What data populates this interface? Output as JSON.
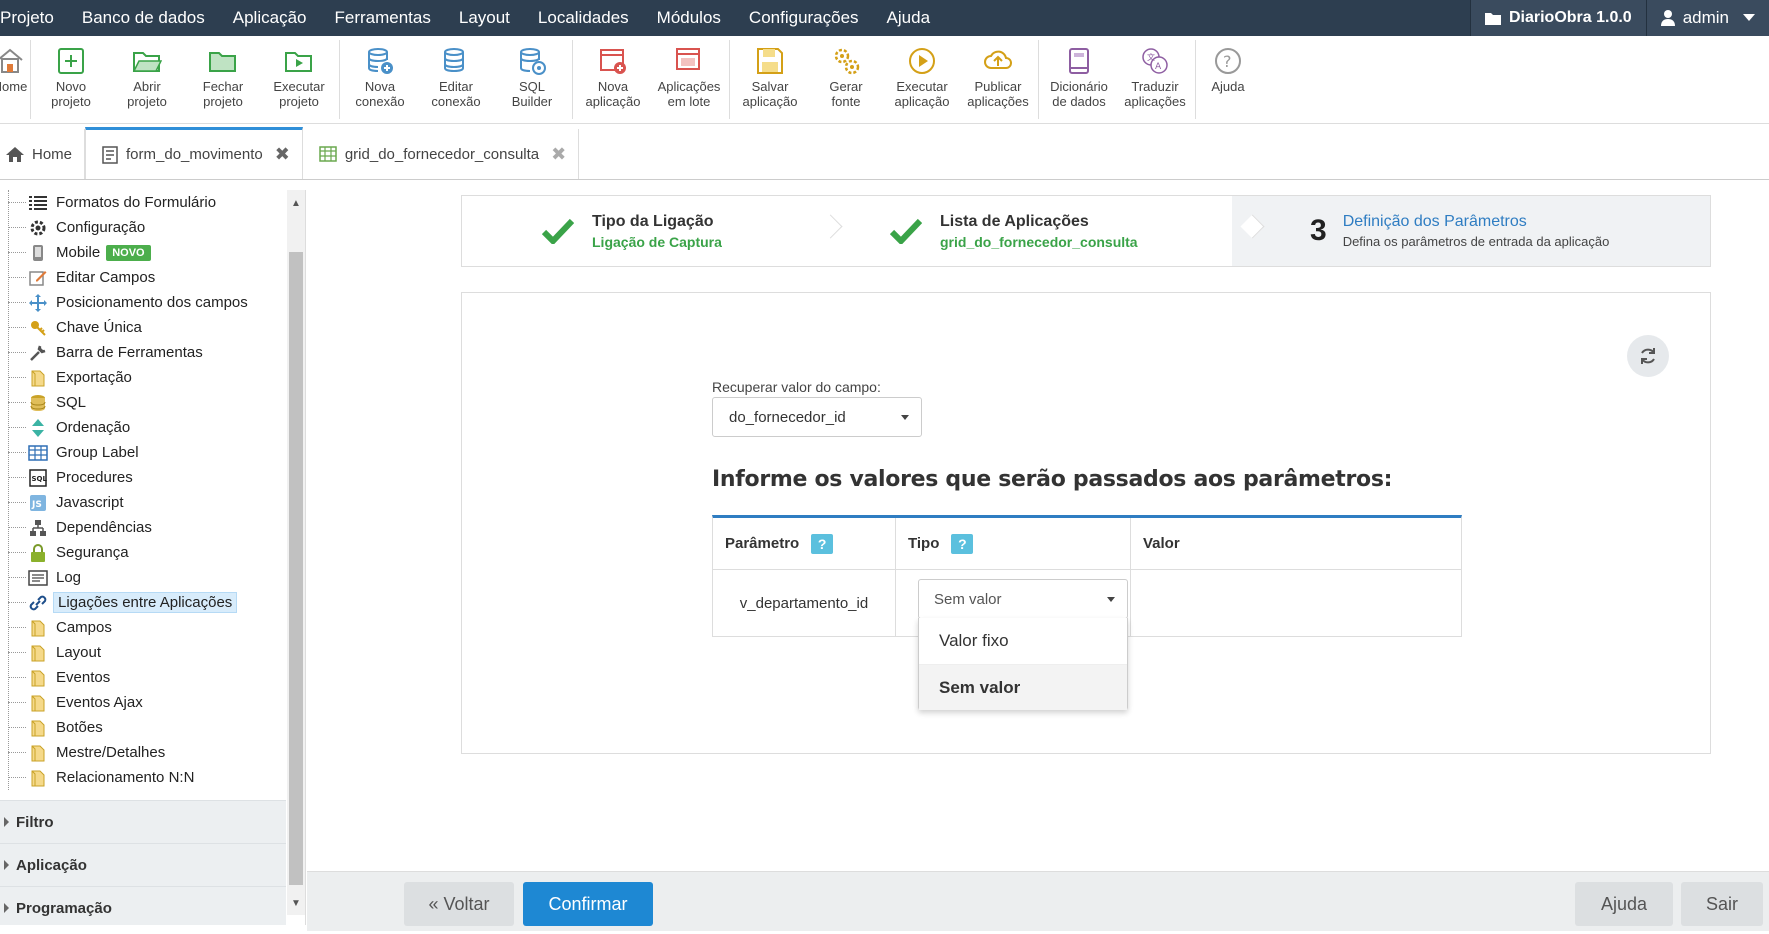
{
  "menubar": {
    "items": [
      "Projeto",
      "Banco de dados",
      "Aplicação",
      "Ferramentas",
      "Layout",
      "Localidades",
      "Módulos",
      "Configurações",
      "Ajuda"
    ],
    "project": "DiarioObra 1.0.0",
    "user": "admin"
  },
  "toolbar": {
    "home": "Home",
    "novo_projeto": [
      "Novo",
      "projeto"
    ],
    "abrir_projeto": [
      "Abrir",
      "projeto"
    ],
    "fechar_projeto": [
      "Fechar",
      "projeto"
    ],
    "executar_projeto": [
      "Executar",
      "projeto"
    ],
    "nova_conexao": [
      "Nova",
      "conexão"
    ],
    "editar_conexao": [
      "Editar",
      "conexão"
    ],
    "sql_builder": [
      "SQL",
      "Builder"
    ],
    "nova_aplicacao": [
      "Nova",
      "aplicação"
    ],
    "aplicacoes_lote": [
      "Aplicações",
      "em lote"
    ],
    "salvar_aplicacao": [
      "Salvar",
      "aplicação"
    ],
    "gerar_fonte": [
      "Gerar",
      "fonte"
    ],
    "executar_aplicacao": [
      "Executar",
      "aplicação"
    ],
    "publicar_aplicacoes": [
      "Publicar",
      "aplicações"
    ],
    "dicionario": [
      "Dicionário",
      "de dados"
    ],
    "traduzir": [
      "Traduzir",
      "aplicações"
    ],
    "ajuda": "Ajuda"
  },
  "tabs": {
    "home": "Home",
    "form": "form_do_movimento",
    "grid": "grid_do_fornecedor_consulta"
  },
  "sidebar": {
    "items": {
      "formatos": "Formatos do Formulário",
      "configuracao": "Configuração",
      "mobile": "Mobile",
      "mobile_badge": "NOVO",
      "editar_campos": "Editar Campos",
      "posicionamento": "Posicionamento dos campos",
      "chave_unica": "Chave Única",
      "barra_ferramentas": "Barra de Ferramentas",
      "exportacao": "Exportação",
      "sql": "SQL",
      "ordenacao": "Ordenação",
      "group_label": "Group Label",
      "procedures": "Procedures",
      "javascript": "Javascript",
      "dependencias": "Dependências",
      "seguranca": "Segurança",
      "log": "Log",
      "ligacoes": "Ligações entre Aplicações",
      "campos": "Campos",
      "layout": "Layout",
      "eventos": "Eventos",
      "eventos_ajax": "Eventos Ajax",
      "botoes": "Botões",
      "mestre_detalhes": "Mestre/Detalhes",
      "relacionamento": "Relacionamento N:N"
    },
    "accordion": {
      "filtro": "Filtro",
      "aplicacao": "Aplicação",
      "programacao": "Programação"
    }
  },
  "steps": {
    "step1": {
      "title": "Tipo da Ligação",
      "subtitle": "Ligação de Captura"
    },
    "step2": {
      "title": "Lista de Aplicações",
      "subtitle": "grid_do_fornecedor_consulta"
    },
    "step3": {
      "number": "3",
      "title": "Definição dos Parâmetros",
      "subtitle": "Defina os parâmetros de entrada da aplicação"
    }
  },
  "form": {
    "recuperar_label": "Recuperar valor do campo:",
    "recuperar_value": "do_fornecedor_id",
    "heading": "Informe os valores que serão passados aos parâmetros:",
    "table": {
      "col_parametro": "Parâmetro",
      "col_tipo": "Tipo",
      "col_valor": "Valor",
      "help": "?",
      "row_param": "v_departamento_id",
      "row_tipo": "Sem valor"
    },
    "dropdown_options": [
      "Valor fixo",
      "Sem valor"
    ]
  },
  "buttons": {
    "voltar": "« Voltar",
    "confirmar": "Confirmar",
    "ajuda": "Ajuda",
    "sair": "Sair"
  },
  "colors": {
    "menubar": "#2d3e50",
    "accent": "#1e88d3",
    "success": "#3aa348",
    "badge": "#4cae4c",
    "help": "#5bc0de"
  }
}
